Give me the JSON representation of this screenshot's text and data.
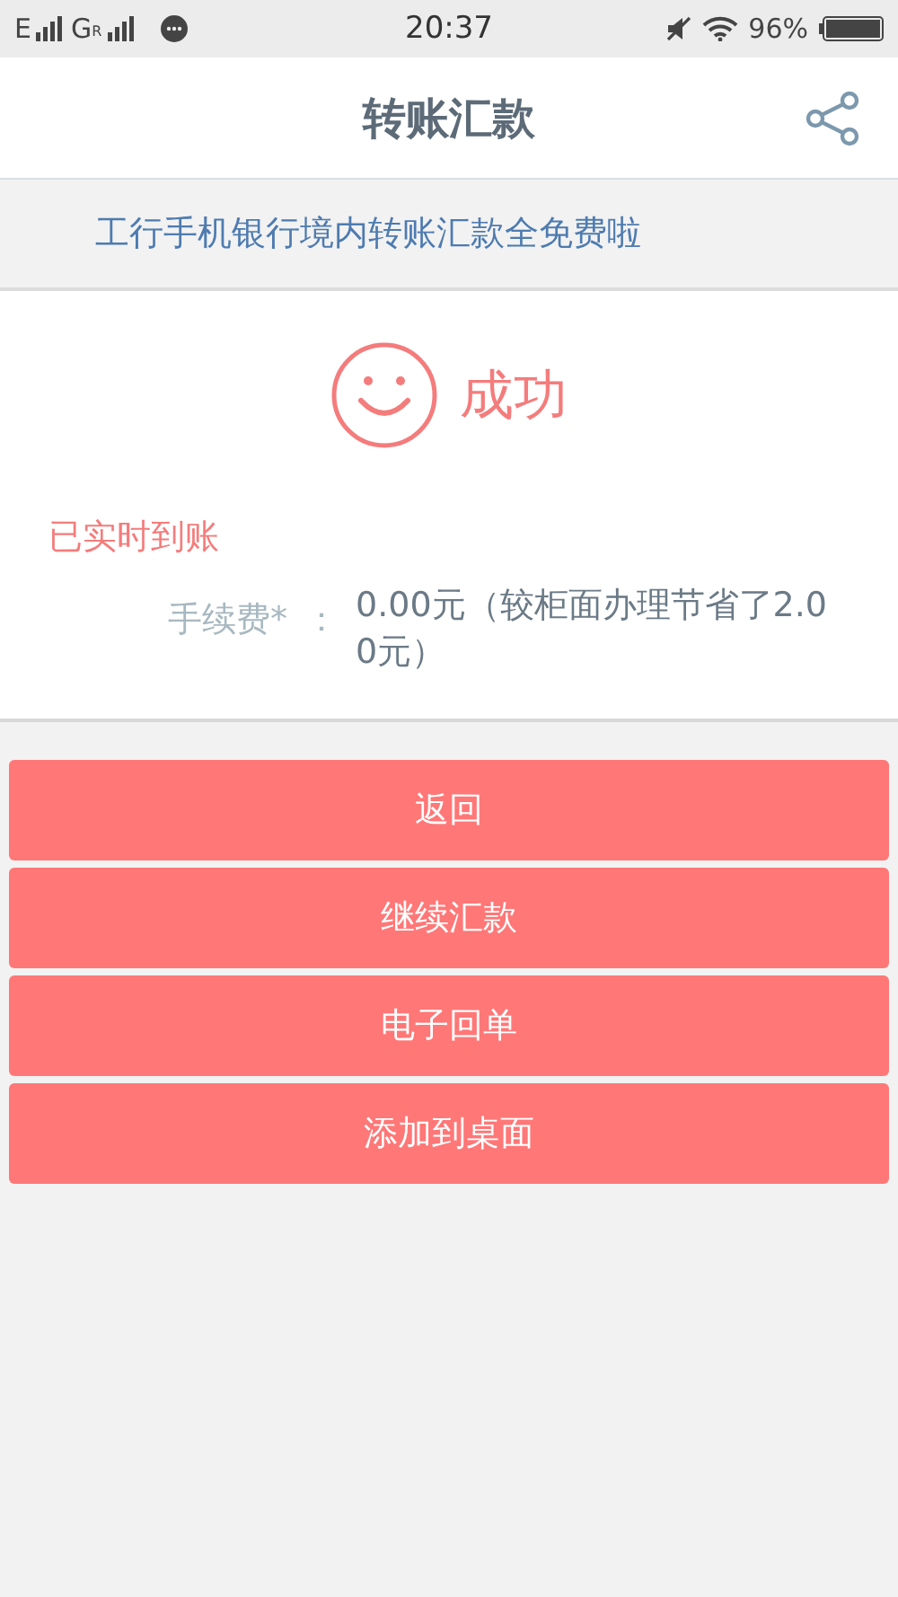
{
  "status_bar": {
    "network_1": "E",
    "network_2": "G",
    "network_2_badge": "R",
    "time": "20:37",
    "battery": "96%"
  },
  "header": {
    "title": "转账汇款"
  },
  "banner": {
    "text": "工行手机银行境内转账汇款全免费啦"
  },
  "result": {
    "status": "成功",
    "arrival": "已实时到账",
    "fee_label": "手续费*",
    "separator": "：",
    "fee_value": "0.00元（较柜面办理节省了2.00元）"
  },
  "buttons": [
    "返回",
    "继续汇款",
    "电子回单",
    "添加到桌面"
  ]
}
